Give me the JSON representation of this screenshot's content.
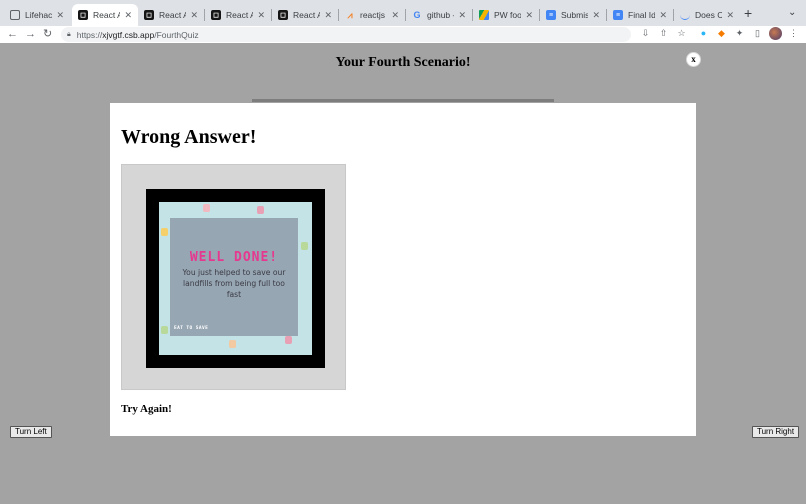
{
  "browser": {
    "tabs": [
      {
        "title": "Lifehack2",
        "favicon": "page-icon",
        "active": false
      },
      {
        "title": "React Ap",
        "favicon": "codesandbox-icon",
        "active": true
      },
      {
        "title": "React Ap",
        "favicon": "codesandbox-icon",
        "active": false
      },
      {
        "title": "React Ap",
        "favicon": "codesandbox-icon",
        "active": false
      },
      {
        "title": "React Ap",
        "favicon": "codesandbox-icon",
        "active": false
      },
      {
        "title": "reactjs -",
        "favicon": "stackoverflow-icon",
        "active": false
      },
      {
        "title": "github -",
        "favicon": "google-icon",
        "active": false
      },
      {
        "title": "PW food",
        "favicon": "google-drive-icon",
        "active": false
      },
      {
        "title": "Submissi",
        "favicon": "google-docs-icon",
        "active": false
      },
      {
        "title": "Final Idea",
        "favicon": "google-docs-icon",
        "active": false
      },
      {
        "title": "Does Cut",
        "favicon": "loading-icon",
        "active": false
      }
    ],
    "url": {
      "protocol": "https://",
      "host": "xjvgtf.csb.app",
      "path": "/FourthQuiz"
    }
  },
  "page": {
    "title": "Your Fourth Scenario!",
    "turn_left": "Turn Left",
    "turn_right": "Turn Right"
  },
  "modal": {
    "close": "x",
    "heading": "Wrong Answer!",
    "image": {
      "headline": "WELL DONE!",
      "message": "You just helped to save our landfills from being full too fast",
      "brand": "EAT TO SAVE"
    },
    "try_again": "Try Again!"
  },
  "colors": {
    "backdrop": "#a3a3a3",
    "modal_bg": "#ffffff",
    "image_accent": "#e6388f",
    "image_bg": "#c3e3e6"
  }
}
